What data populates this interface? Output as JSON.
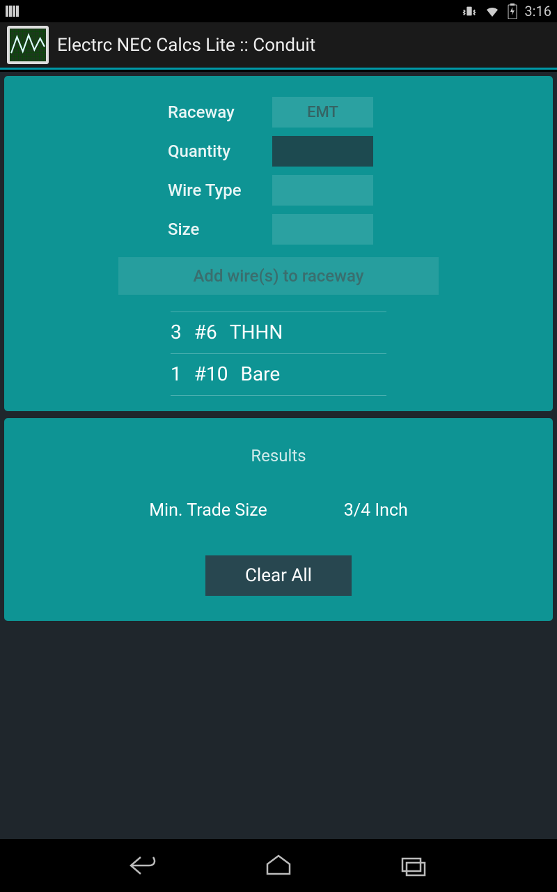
{
  "status": {
    "time": "3:16"
  },
  "header": {
    "title": "Electrc NEC Calcs Lite :: Conduit"
  },
  "form": {
    "raceway_label": "Raceway",
    "raceway_value": "EMT",
    "quantity_label": "Quantity",
    "quantity_value": "",
    "wiretype_label": "Wire Type",
    "wiretype_value": "",
    "size_label": "Size",
    "size_value": "",
    "add_button": "Add wire(s) to raceway"
  },
  "wires": [
    {
      "qty": "3",
      "size": "#6",
      "type": "THHN"
    },
    {
      "qty": "1",
      "size": "#10",
      "type": "Bare"
    }
  ],
  "results": {
    "title": "Results",
    "label": "Min. Trade Size",
    "value": "3/4 Inch",
    "clear_button": "Clear All"
  }
}
